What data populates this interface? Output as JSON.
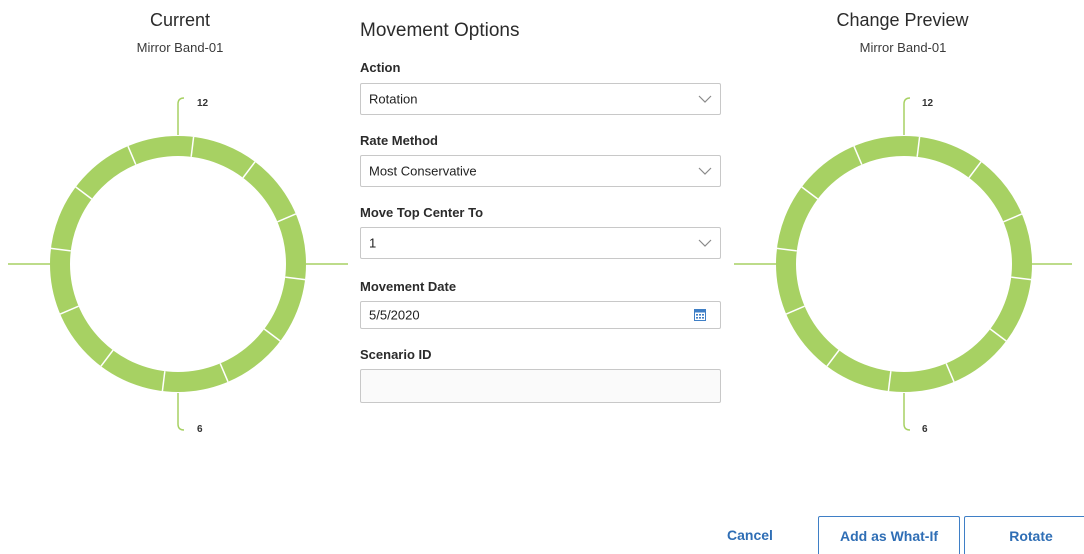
{
  "current": {
    "title": "Current",
    "band_name": "Mirror Band-01",
    "top_label": "12",
    "bottom_label": "6"
  },
  "preview": {
    "title": "Change Preview",
    "band_name": "Mirror Band-01",
    "top_label": "12",
    "bottom_label": "6"
  },
  "ring": {
    "segment_count": 12,
    "color": "#a7d163"
  },
  "movement_options": {
    "title": "Movement Options",
    "action": {
      "label": "Action",
      "value": "Rotation"
    },
    "rate_method": {
      "label": "Rate Method",
      "value": "Most Conservative"
    },
    "move_top_center": {
      "label": "Move Top Center To",
      "value": "1"
    },
    "movement_date": {
      "label": "Movement Date",
      "value": "5/5/2020"
    },
    "scenario_id": {
      "label": "Scenario ID",
      "value": ""
    }
  },
  "buttons": {
    "cancel": "Cancel",
    "add_what_if": "Add as What-If",
    "rotate": "Rotate"
  },
  "colors": {
    "accent_blue": "#2f6eb5",
    "ring_green": "#a7d163"
  }
}
